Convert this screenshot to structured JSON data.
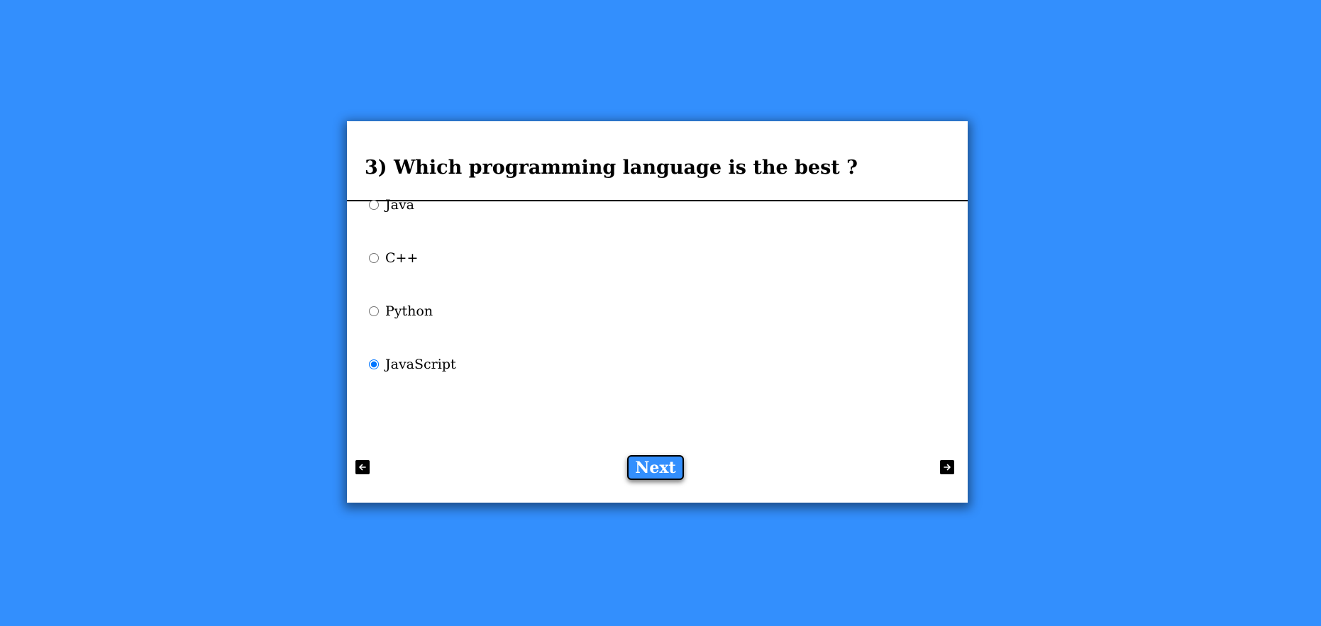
{
  "quiz": {
    "question": "3) Which programming language is the best ?",
    "selected_option": "JavaScript",
    "options": [
      {
        "label": "Java"
      },
      {
        "label": "C++"
      },
      {
        "label": "Python"
      },
      {
        "label": "JavaScript"
      }
    ],
    "next_label": "Next",
    "prev_icon": "arrow-left-icon",
    "next_icon": "arrow-right-icon"
  },
  "colors": {
    "background": "#338ffd",
    "card": "#ffffff",
    "button": "#338ffd",
    "radio_selected": "#1a73e8"
  }
}
